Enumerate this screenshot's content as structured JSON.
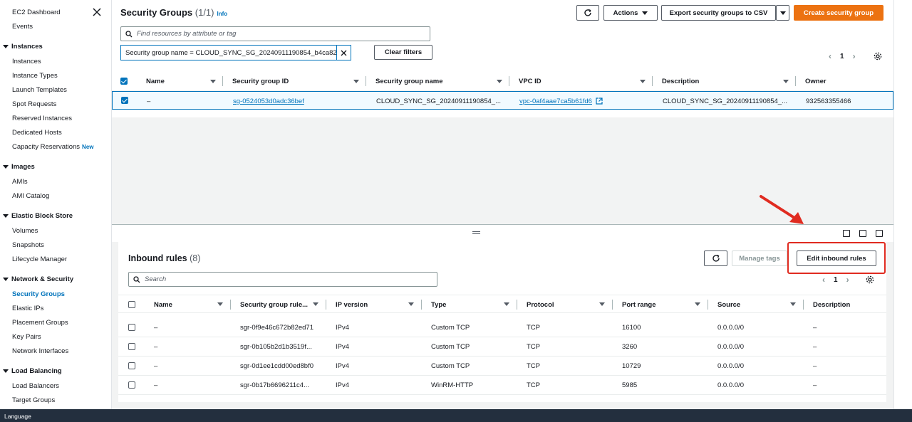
{
  "sidebar": {
    "top_items": [
      "EC2 Dashboard",
      "Events"
    ],
    "sections": [
      {
        "title": "Instances",
        "items": [
          "Instances",
          "Instance Types",
          "Launch Templates",
          "Spot Requests",
          "Reserved Instances",
          "Dedicated Hosts",
          "Capacity Reservations"
        ]
      },
      {
        "title": "Images",
        "items": [
          "AMIs",
          "AMI Catalog"
        ]
      },
      {
        "title": "Elastic Block Store",
        "items": [
          "Volumes",
          "Snapshots",
          "Lifecycle Manager"
        ]
      },
      {
        "title": "Network & Security",
        "items": [
          "Security Groups",
          "Elastic IPs",
          "Placement Groups",
          "Key Pairs",
          "Network Interfaces"
        ]
      },
      {
        "title": "Load Balancing",
        "items": [
          "Load Balancers",
          "Target Groups"
        ]
      }
    ],
    "new_badge": "New",
    "active_item": "Security Groups"
  },
  "language_label": "Language",
  "header": {
    "title": "Security Groups",
    "count": "(1/1)",
    "info": "Info",
    "actions_label": "Actions",
    "export_label": "Export security groups to CSV",
    "create_label": "Create security group",
    "search_placeholder": "Find resources by attribute or tag",
    "filter_chip": "Security group name = CLOUD_SYNC_SG_20240911190854_b4ca82",
    "clear_filters": "Clear filters",
    "page": "1"
  },
  "sg_table": {
    "columns": [
      "Name",
      "Security group ID",
      "Security group name",
      "VPC ID",
      "Description",
      "Owner"
    ],
    "row": {
      "name": "–",
      "id": "sg-0524053d0adc36bef",
      "group_name": "CLOUD_SYNC_SG_20240911190854_...",
      "vpc": "vpc-0af4aae7ca5b61fd6",
      "description": "CLOUD_SYNC_SG_20240911190854_...",
      "owner": "932563355466"
    }
  },
  "inbound": {
    "title": "Inbound rules",
    "count": "(8)",
    "manage_tags": "Manage tags",
    "edit_label": "Edit inbound rules",
    "search_placeholder": "Search",
    "page": "1",
    "columns": [
      "Name",
      "Security group rule...",
      "IP version",
      "Type",
      "Protocol",
      "Port range",
      "Source",
      "Description"
    ],
    "rows": [
      {
        "name": "–",
        "rule": "sgr-0f9e46c672b82ed71",
        "ip": "IPv4",
        "type": "Custom TCP",
        "protocol": "TCP",
        "port": "16100",
        "source": "0.0.0.0/0",
        "desc": "–"
      },
      {
        "name": "–",
        "rule": "sgr-0b105b2d1b3519f...",
        "ip": "IPv4",
        "type": "Custom TCP",
        "protocol": "TCP",
        "port": "3260",
        "source": "0.0.0.0/0",
        "desc": "–"
      },
      {
        "name": "–",
        "rule": "sgr-0d1ee1cdd00ed8bf0",
        "ip": "IPv4",
        "type": "Custom TCP",
        "protocol": "TCP",
        "port": "10729",
        "source": "0.0.0.0/0",
        "desc": "–"
      },
      {
        "name": "–",
        "rule": "sgr-0b17b6696211c4...",
        "ip": "IPv4",
        "type": "WinRM-HTTP",
        "protocol": "TCP",
        "port": "5985",
        "source": "0.0.0.0/0",
        "desc": "–"
      }
    ]
  },
  "colors": {
    "accent": "#0073bb",
    "primary": "#ec7211",
    "highlight": "#e02b20"
  }
}
